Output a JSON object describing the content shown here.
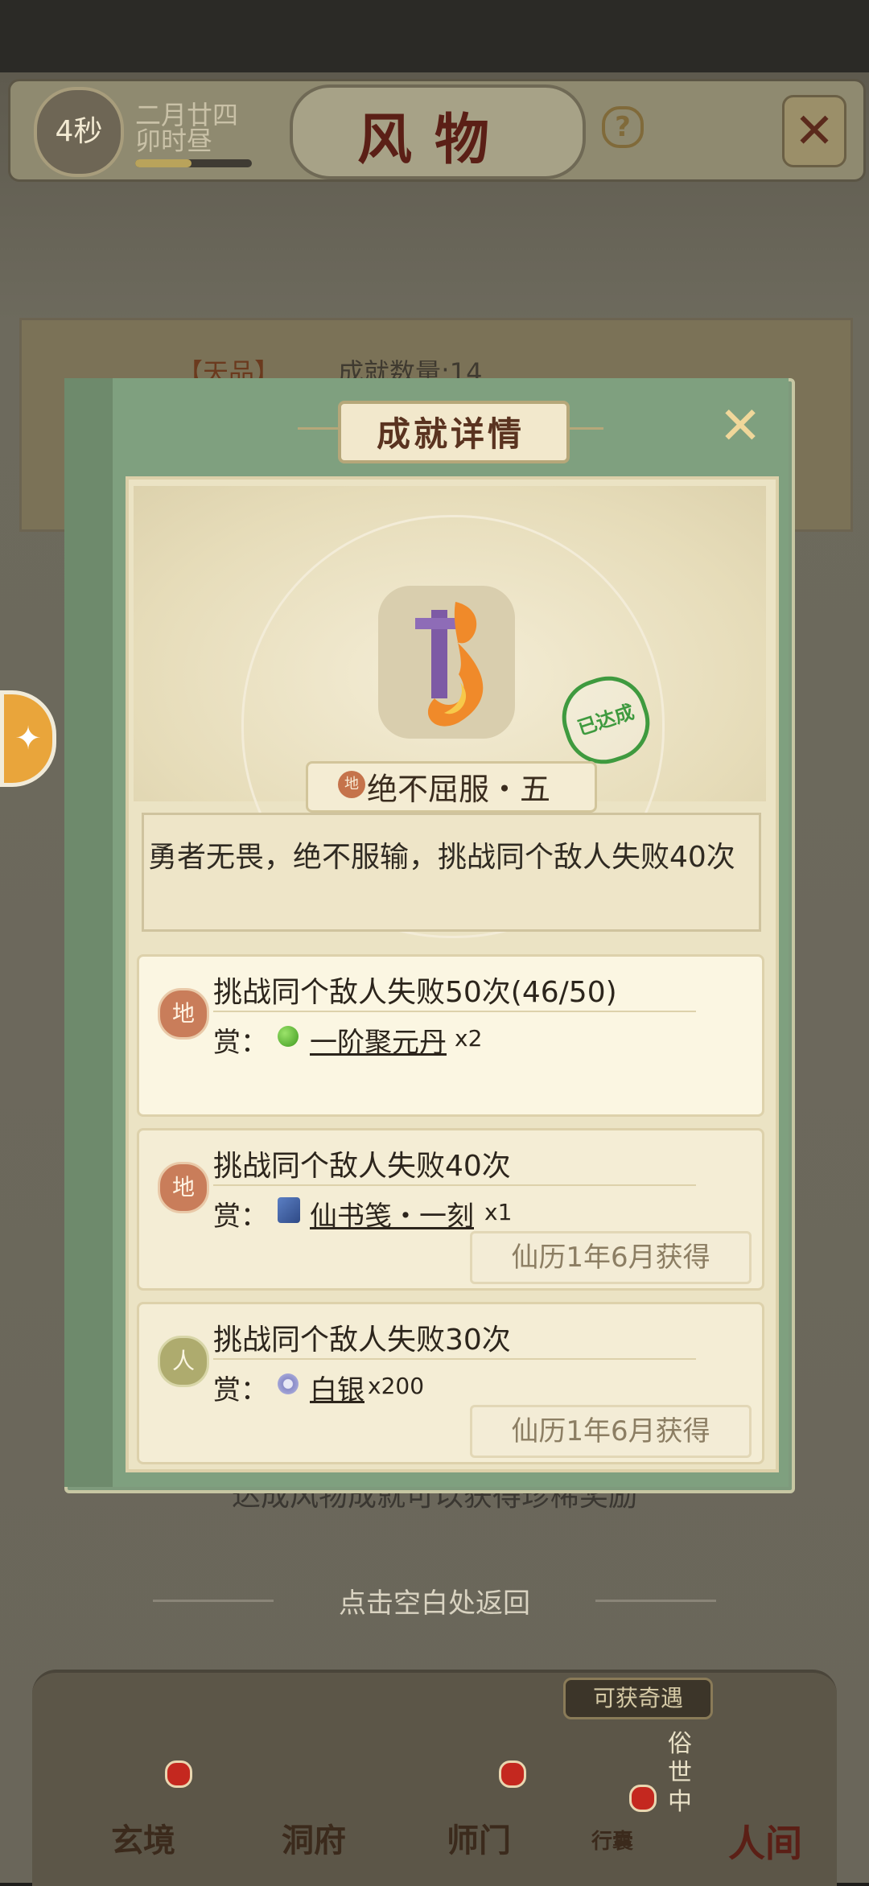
{
  "header": {
    "timer": "4秒",
    "date_line1": "二月廿四",
    "date_line2": "卯时昼",
    "title": "风物",
    "help_icon": "question-icon",
    "close_icon": "close-x-icon"
  },
  "background": {
    "tier_label": "【天品】",
    "count_label": "成就数量:14",
    "bottom_text": "达成风物成就可以获得珍稀奖励",
    "return_hint": "点击空白处返回"
  },
  "modal": {
    "title": "成就详情",
    "achievement_tier": "地",
    "achievement_name": "绝不屈服・五",
    "status_stamp": "已达成",
    "description": "勇者无畏，绝不服输，挑战同个敌人失败40次",
    "items": [
      {
        "tier": "地",
        "title": "挑战同个敌人失败50次(46/50)",
        "reward_label": "赏：",
        "reward_icon": "green-pill-icon",
        "reward_name": "一阶聚元丹",
        "reward_qty": "x2",
        "obtained": ""
      },
      {
        "tier": "地",
        "title": "挑战同个敌人失败40次",
        "reward_label": "赏：",
        "reward_icon": "scroll-book-icon",
        "reward_name": "仙书笺・一刻",
        "reward_qty": "x1",
        "obtained": "仙历1年6月获得"
      },
      {
        "tier": "人",
        "title": "挑战同个敌人失败30次",
        "reward_label": "赏：",
        "reward_icon": "silver-coin-icon",
        "reward_name": "白银",
        "reward_qty": "x200",
        "obtained": "仙历1年6月获得"
      }
    ]
  },
  "nav": {
    "items": [
      "玄境",
      "洞府",
      "师门",
      "行囊",
      "人间"
    ],
    "bag_tag": "可获奇遇",
    "vertical_label": "俗世中"
  },
  "colors": {
    "modal_green": "#7fa07f",
    "card_bg": "#ebe3c4",
    "title_red": "#5b1f16",
    "stamp_green": "#3f9a3f"
  }
}
